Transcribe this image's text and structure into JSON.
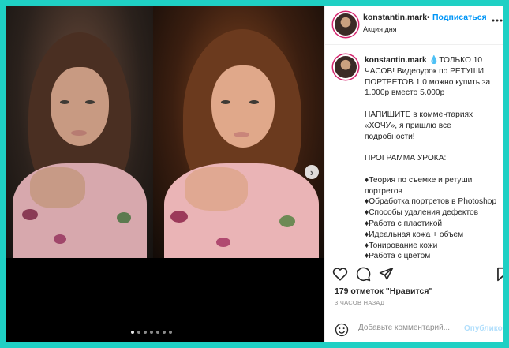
{
  "post": {
    "username": "konstantin.mark",
    "separator": "•",
    "follow_label": "Подписаться",
    "location": "Акция дня",
    "more_icon": "more-icon",
    "caption_username": "konstantin.mark",
    "caption_text": " 💧ТОЛЬКО 10 ЧАСОВ! Видеоурок по РЕТУШИ ПОРТРЕТОВ 1.0 можно купить за 1.000р вместо 5.000р\n\nНАПИШИТЕ в комментариях «ХОЧУ», я пришлю все подробности!\n\nПРОГРАММА УРОКА:\n\n♦Теория по съемке и ретуши портретов\n♦Обработка портретов в Photoshop\n♦Способы удаления дефектов\n♦Работа с пластикой\n♦Идеальная кожа + объем\n♦Тонирование кожи\n♦Работа с цветом",
    "likes": "179 отметок \"Нравится\"",
    "time": "3 ЧАСОВ НАЗАД",
    "comment_placeholder": "Добавьте комментарий...",
    "publish_label": "Опубликовать"
  },
  "carousel": {
    "slide_count": 7,
    "active_slide": 1,
    "next_icon": "chevron-right-icon"
  },
  "icons": {
    "like": "heart-icon",
    "comment": "comment-icon",
    "share": "send-icon",
    "save": "bookmark-icon",
    "emoji": "smiley-icon"
  },
  "colors": {
    "background": "#1fd0c4",
    "link": "#0095f6",
    "publish_disabled": "#b2dffc",
    "text": "#262626",
    "muted": "#8e8e8e",
    "story_ring": "#d4256e"
  }
}
